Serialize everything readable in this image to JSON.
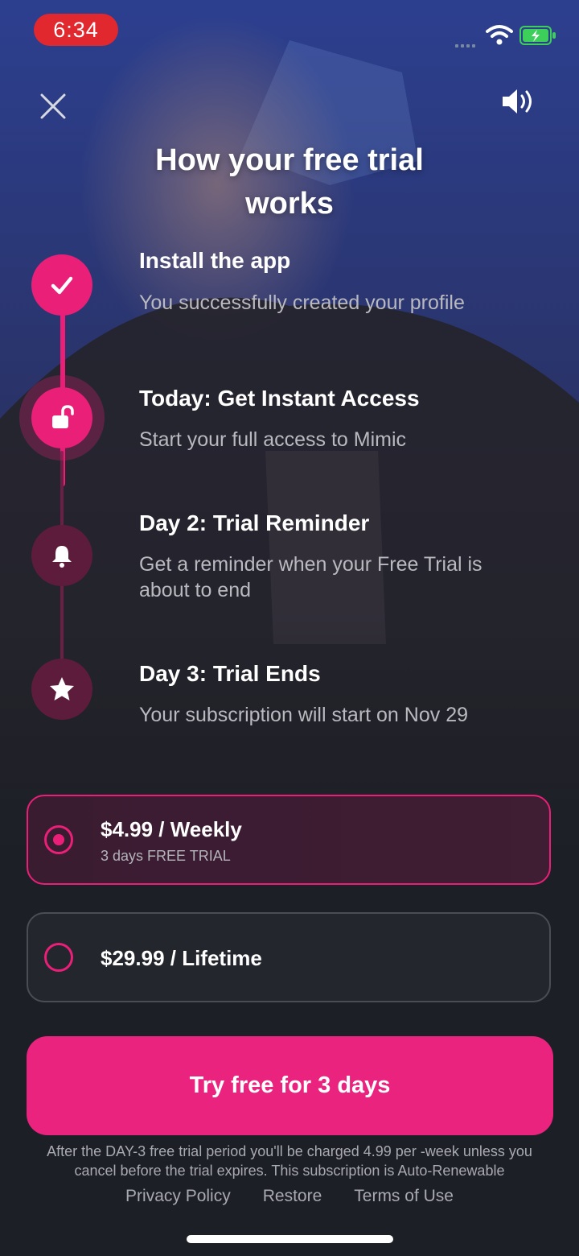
{
  "status_bar": {
    "time": "6:34",
    "time_pill_color": "#e0282e"
  },
  "header": {
    "close_icon": "close-icon",
    "sound_icon": "speaker-icon"
  },
  "title": {
    "line1": "How your free trial",
    "line2": "works"
  },
  "steps": [
    {
      "title": "Install the app",
      "desc": "You successfully created your profile",
      "icon": "checkmark-icon"
    },
    {
      "title": "Today: Get Instant Access",
      "desc": "Start your full access to Mimic",
      "icon": "unlock-icon"
    },
    {
      "title": "Day 2: Trial Reminder",
      "desc_line1": "Get a reminder when your Free Trial is",
      "desc_line2": "about to end",
      "icon": "bell-icon"
    },
    {
      "title": "Day 3: Trial Ends",
      "desc": "Your subscription will start on Nov 29",
      "icon": "star-icon"
    }
  ],
  "plans": [
    {
      "title": "$4.99 / Weekly",
      "subtitle": "3 days FREE TRIAL",
      "selected": true
    },
    {
      "title": "$29.99 / Lifetime",
      "selected": false
    }
  ],
  "cta": {
    "label": "Try free for 3 days"
  },
  "legal": {
    "line1": "After the DAY-3 free trial period you'll be charged 4.99 per -week unless you",
    "line2": "cancel before the trial expires. This subscription is Auto-Renewable"
  },
  "links": {
    "privacy": "Privacy Policy",
    "restore": "Restore",
    "terms": "Terms of Use"
  },
  "colors": {
    "accent": "#e91f78",
    "background": "#1d1f26",
    "plan_border": "#4b4d55"
  }
}
